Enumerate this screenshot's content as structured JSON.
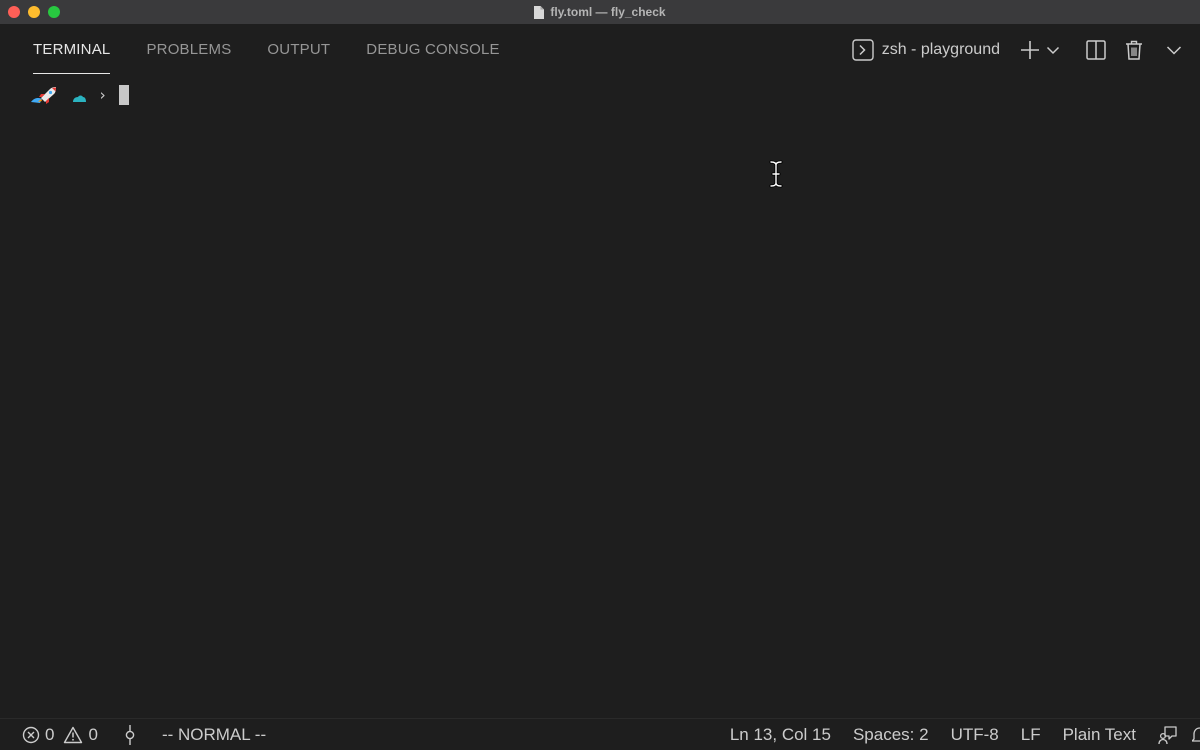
{
  "window": {
    "title": "fly.toml — fly_check"
  },
  "panel": {
    "tabs": [
      {
        "label": "TERMINAL",
        "active": true
      },
      {
        "label": "PROBLEMS",
        "active": false
      },
      {
        "label": "OUTPUT",
        "active": false
      },
      {
        "label": "DEBUG CONSOLE",
        "active": false
      }
    ],
    "terminal_selector": "zsh - playground"
  },
  "terminal": {
    "prompt_symbol": "›"
  },
  "statusbar": {
    "errors": "0",
    "warnings": "0",
    "mode": "-- NORMAL --",
    "position": "Ln 13, Col 15",
    "spaces": "Spaces: 2",
    "encoding": "UTF-8",
    "eol": "LF",
    "language": "Plain Text"
  },
  "icons": {
    "close": "close-dot",
    "minimize": "minimize-dot",
    "maximize": "maximize-dot",
    "file": "file-icon",
    "terminal": "terminal-icon",
    "add": "plus-icon",
    "dropdown": "chevron-down-icon",
    "split": "split-icon",
    "trash": "trash-icon",
    "collapse": "chevron-down-icon",
    "error": "error-icon",
    "warning": "warning-icon",
    "branch": "git-commit-icon",
    "feedback": "feedback-icon"
  },
  "colors": {
    "background": "#1e1e1e",
    "titlebar": "#3a3a3c",
    "tab_active": "#e7e7e7",
    "tab_inactive": "#969696",
    "rocket_blue": "#3fa9f5",
    "cloud_teal": "#2bb3c0"
  }
}
